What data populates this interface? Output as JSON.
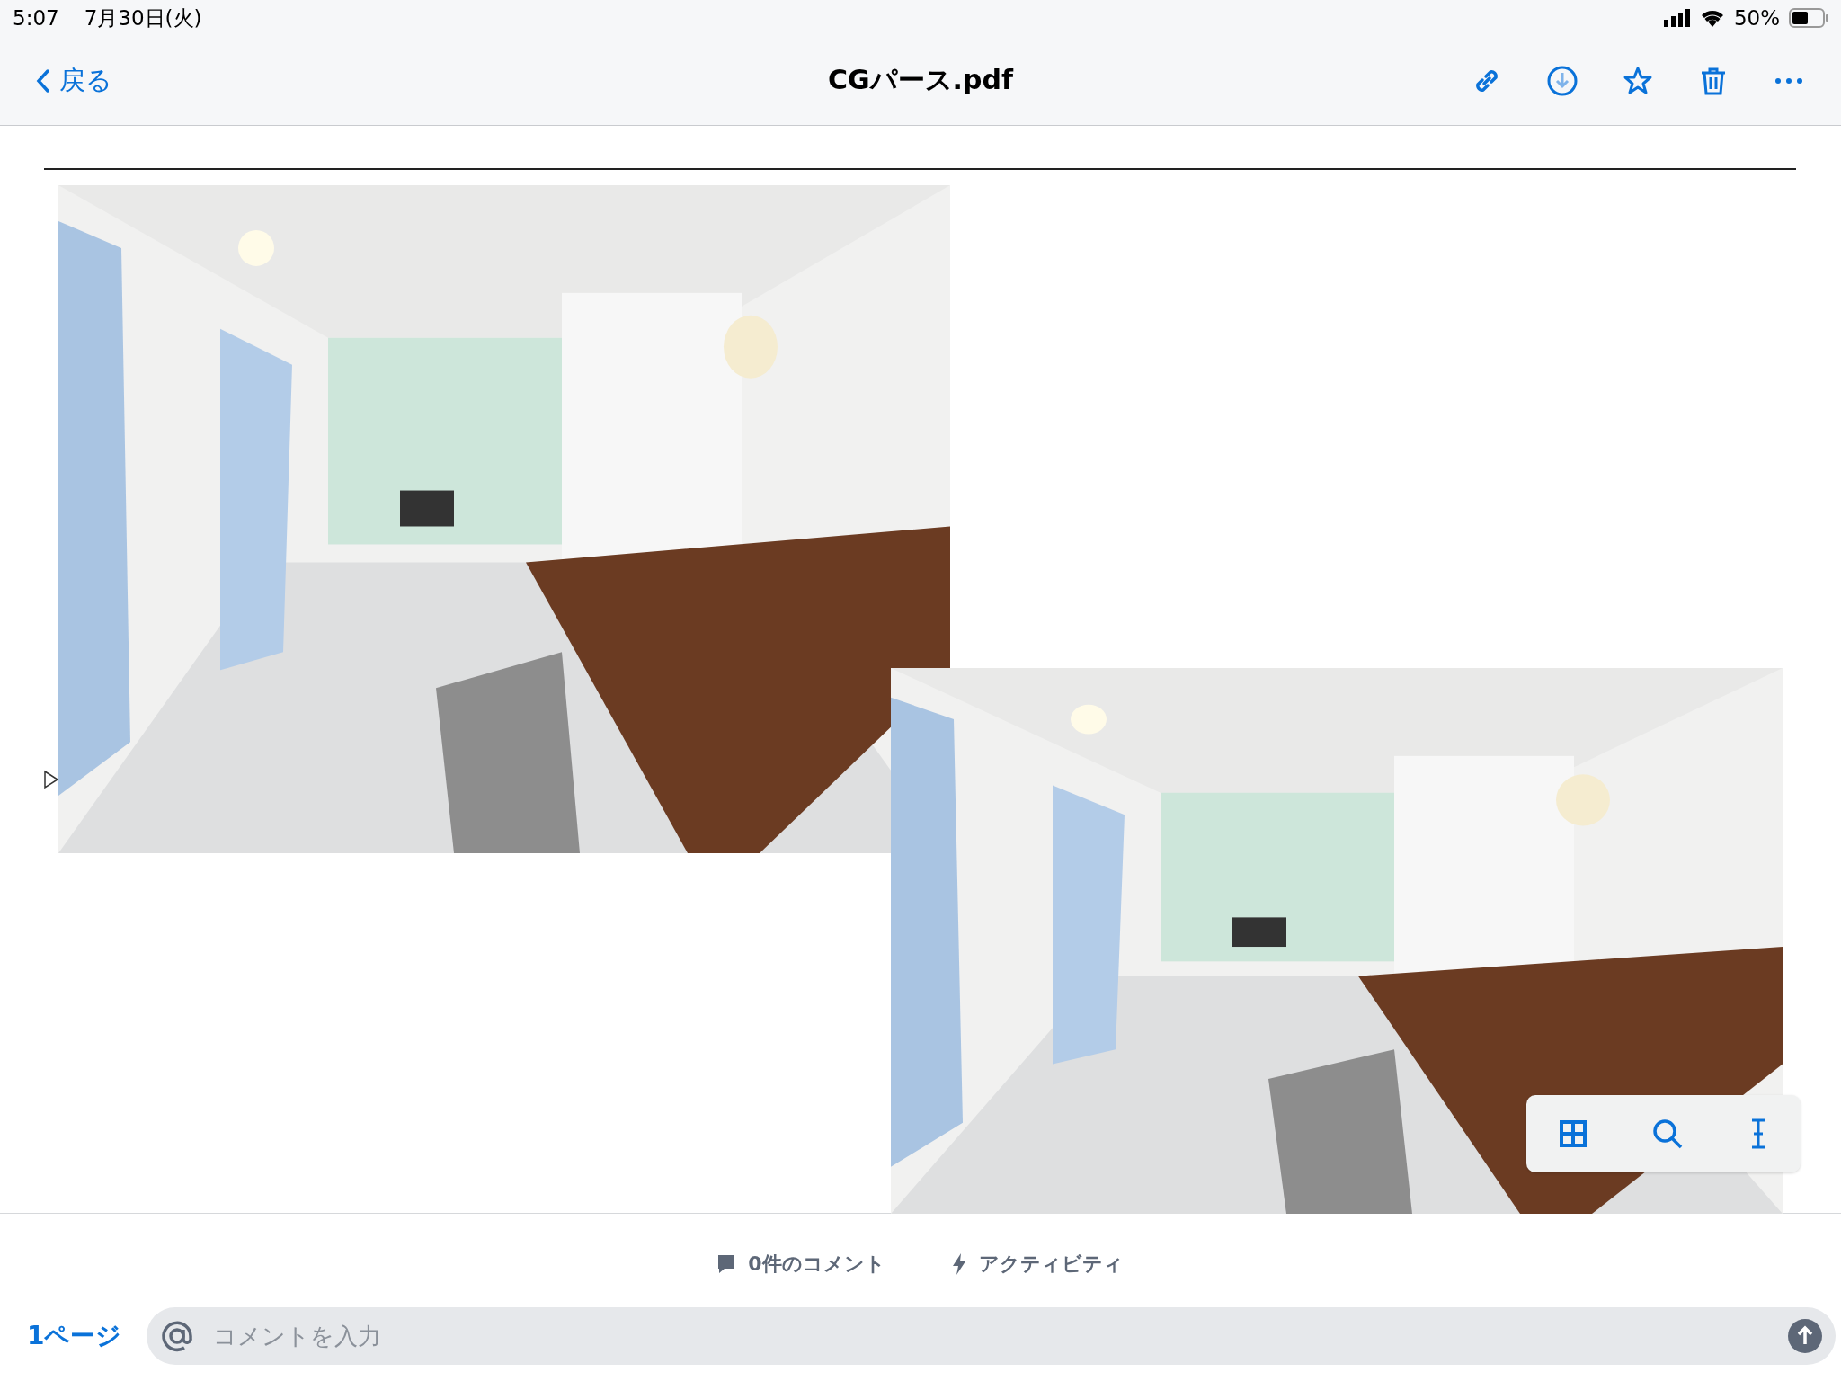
{
  "status_bar": {
    "time": "5:07",
    "date": "7月30日(火)",
    "battery": "50%"
  },
  "nav": {
    "back": "戻る",
    "title": "CGパース.pdf"
  },
  "footer": {
    "comments": "0件のコメント",
    "activity": "アクティビティ",
    "page": "1ページ",
    "comment_field": {
      "placeholder": "コメントを入力"
    }
  }
}
